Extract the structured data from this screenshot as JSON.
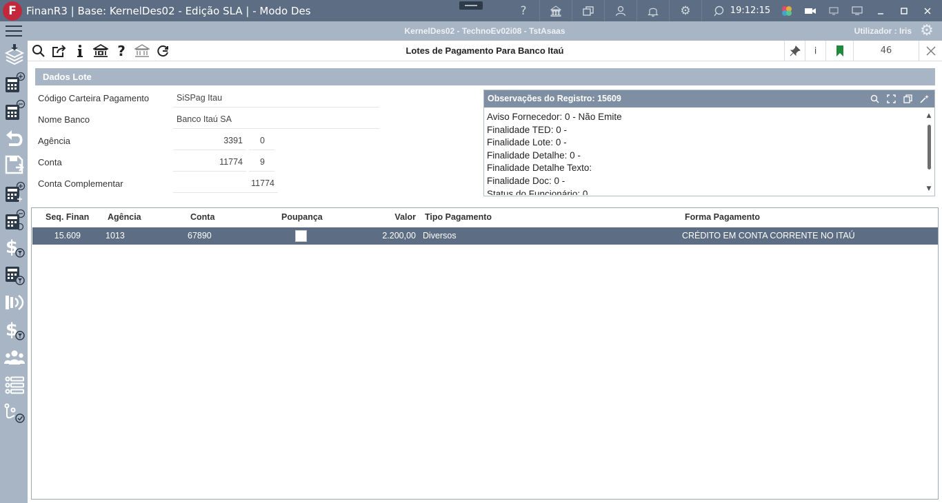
{
  "titlebar": {
    "logo": "F",
    "title": "FinanR3 | Base: KernelDes02 - Edição SLA | - Modo Des",
    "clock": "19:12:15",
    "icons": [
      "help-icon",
      "bank-icon",
      "windows-icon",
      "user-icon",
      "bell-icon",
      "gear-icon",
      "chat-icon"
    ],
    "window_controls": [
      "camera-icon",
      "monitor-small-icon",
      "monitor-icon",
      "minimize-icon",
      "maximize-icon",
      "close-icon"
    ]
  },
  "subbar": {
    "session": "KernelDes02 - TechnoEv02i08 - TstAsaas",
    "user": "Utilizador : Iris"
  },
  "toolbar": {
    "title": "Lotes de Pagamento Para Banco Itaú",
    "info": "i",
    "record_count": "46",
    "icons": [
      "search-icon",
      "export-icon",
      "info-icon",
      "bank-icon",
      "help-icon",
      "bank-outline-icon",
      "refresh-icon"
    ]
  },
  "section": {
    "title": "Dados Lote"
  },
  "form": {
    "codigo_label": "Código Carteira Pagamento",
    "codigo_value": "SiSPag Itau",
    "nome_banco_label": "Nome Banco",
    "nome_banco_value": "Banco Itaú SA",
    "agencia_label": "Agência",
    "agencia_value": "3391",
    "agencia_digito": "0",
    "conta_label": "Conta",
    "conta_value": "11774",
    "conta_digito": "9",
    "conta_comp_label": "Conta Complementar",
    "conta_comp_value": "11774"
  },
  "observations": {
    "title": "Observações do Registro: 15609",
    "lines": [
      "Aviso Fornecedor: 0 - Não Emite",
      "Finalidade TED: 0 -",
      "Finalidade Lote: 0 -",
      "Finalidade Detalhe: 0 -",
      "Finalidade Detalhe Texto:",
      "Finalidade Doc: 0 -",
      "Status do Funcionário: 0"
    ]
  },
  "grid": {
    "headers": {
      "seq": "Seq. Finan",
      "agencia": "Agência",
      "conta": "Conta",
      "poupanca": "Poupança",
      "valor": "Valor",
      "tipo": "Tipo Pagamento",
      "forma": "Forma Pagamento"
    },
    "rows": [
      {
        "seq": "15.609",
        "agencia": "1013",
        "conta": "67890",
        "poupanca": false,
        "valor": "2.200,00",
        "tipo": "Diversos",
        "forma": "CRÉDITO EM CONTA CORRENTE NO ITAÚ"
      }
    ]
  },
  "colors": {
    "titlebar": "#5d6e84",
    "subbar": "#a8b5c4",
    "selected_row": "#5d6e84",
    "logo": "#c2273b",
    "bookmark": "#1f8a3b"
  }
}
